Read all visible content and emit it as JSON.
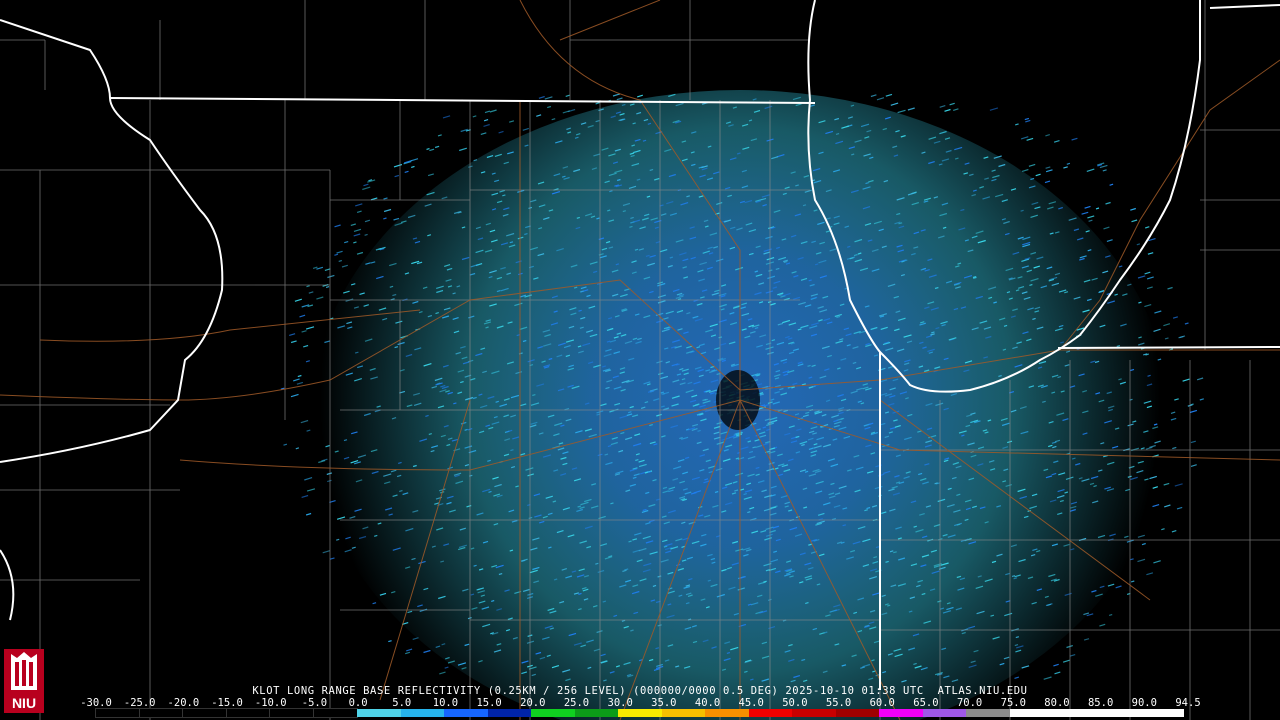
{
  "caption": "KLOT LONG RANGE BASE REFLECTIVITY (0.25KM / 256 LEVEL) (000000/0000 0.5 DEG) 2025-10-10 01:38 UTC  ATLAS.NIU.EDU",
  "logo_text": "NIU",
  "colorbar": {
    "ticks": [
      "-30.0",
      "-25.0",
      "-20.0",
      "-15.0",
      "-10.0",
      "-5.0",
      "0.0",
      "5.0",
      "10.0",
      "15.0",
      "20.0",
      "25.0",
      "30.0",
      "35.0",
      "40.0",
      "45.0",
      "50.0",
      "55.0",
      "60.0",
      "65.0",
      "70.0",
      "75.0",
      "80.0",
      "85.0",
      "90.0",
      "94.5"
    ],
    "colors": [
      "#000000",
      "#000000",
      "#000000",
      "#000000",
      "#000000",
      "#000000",
      "#4fd3e8",
      "#26b4ec",
      "#1666ff",
      "#0024a8",
      "#10d020",
      "#0c9c18",
      "#f8ec00",
      "#f6c000",
      "#f89000",
      "#f00000",
      "#c80000",
      "#a00000",
      "#f000f8",
      "#a058e8",
      "#8c8c8c",
      "#ffffff",
      "#ffffff",
      "#ffffff",
      "#ffffff"
    ]
  }
}
